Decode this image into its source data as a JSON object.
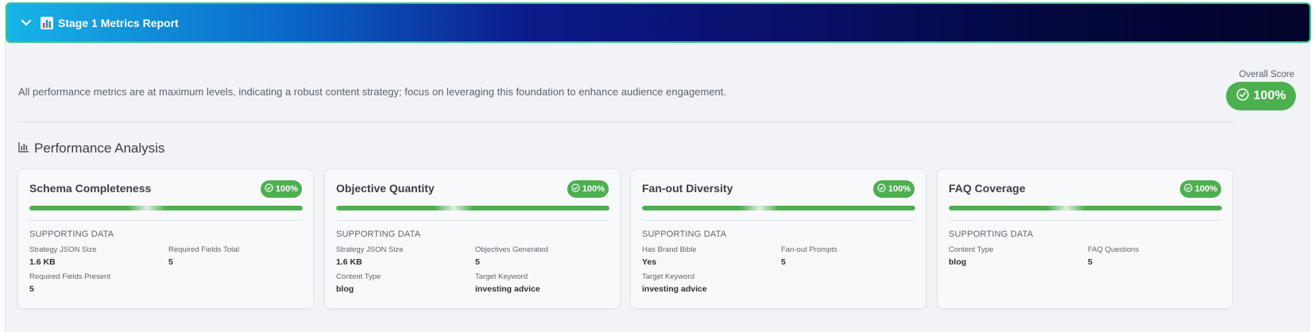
{
  "header": {
    "title": "Stage 1 Metrics Report",
    "expanded": true
  },
  "summary": {
    "text": "All performance metrics are at maximum levels, indicating a robust content strategy; focus on leveraging this foundation to enhance audience engagement."
  },
  "overall": {
    "label": "Overall Score",
    "value": "100%",
    "progress": 1.0
  },
  "section": {
    "title": "Performance Analysis"
  },
  "colors": {
    "success": "#4caf50",
    "header_start": "#18b4e8",
    "header_end": "#02042a"
  },
  "cards": [
    {
      "title": "Schema Completeness",
      "score": "100%",
      "progress": 1.0,
      "supporting_label": "SUPPORTING DATA",
      "items": [
        {
          "label": "Strategy JSON Size",
          "value": "1.6 KB"
        },
        {
          "label": "Required Fields Total",
          "value": "5"
        },
        {
          "label": "Required Fields Present",
          "value": "5"
        }
      ]
    },
    {
      "title": "Objective Quantity",
      "score": "100%",
      "progress": 1.0,
      "supporting_label": "SUPPORTING DATA",
      "items": [
        {
          "label": "Strategy JSON Size",
          "value": "1.6 KB"
        },
        {
          "label": "Objectives Generated",
          "value": "5"
        },
        {
          "label": "Content Type",
          "value": "blog"
        },
        {
          "label": "Target Keyword",
          "value": "investing advice"
        }
      ]
    },
    {
      "title": "Fan-out Diversity",
      "score": "100%",
      "progress": 1.0,
      "supporting_label": "SUPPORTING DATA",
      "items": [
        {
          "label": "Has Brand Bible",
          "value": "Yes"
        },
        {
          "label": "Fan-out Prompts",
          "value": "5"
        },
        {
          "label": "Target Keyword",
          "value": "investing advice"
        }
      ]
    },
    {
      "title": "FAQ Coverage",
      "score": "100%",
      "progress": 1.0,
      "supporting_label": "SUPPORTING DATA",
      "items": [
        {
          "label": "Content Type",
          "value": "blog"
        },
        {
          "label": "FAQ Questions",
          "value": "5"
        }
      ]
    }
  ]
}
